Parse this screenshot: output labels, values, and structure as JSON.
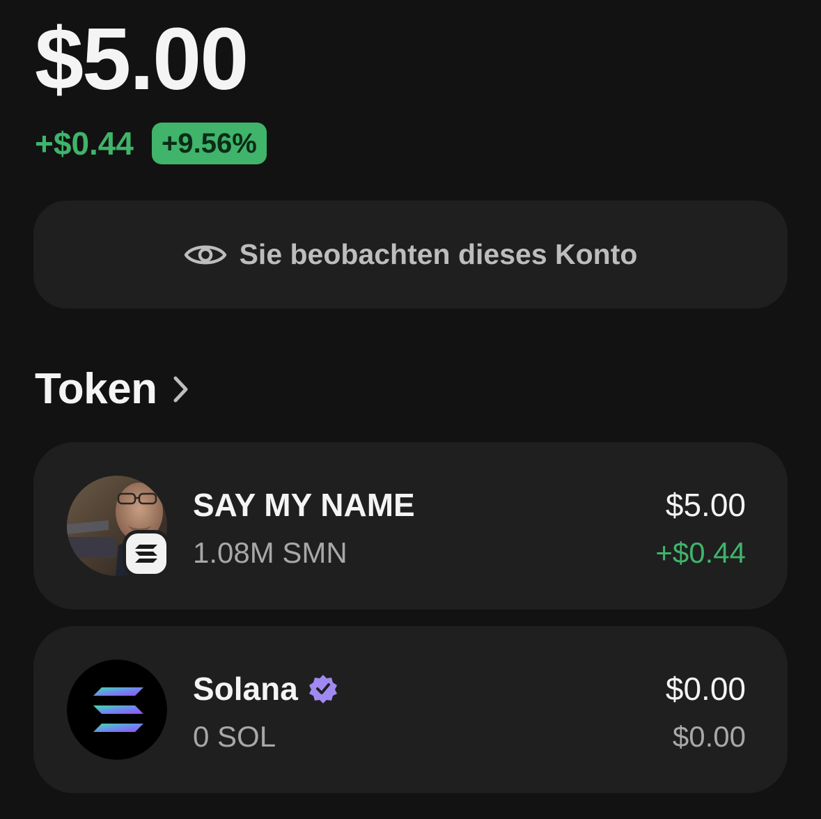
{
  "portfolio": {
    "balance": "$5.00",
    "change_abs": "+$0.44",
    "change_pct": "+9.56%"
  },
  "watch_banner": {
    "text": "Sie beobachten dieses Konto",
    "icon": "eye-icon"
  },
  "tokens_section": {
    "title": "Token",
    "icon": "chevron-right-icon"
  },
  "tokens": [
    {
      "name": "SAY MY NAME",
      "amount": "1.08M SMN",
      "value": "$5.00",
      "change": "+$0.44",
      "change_color": "#3fb46a",
      "icon": "token-avatar-photo",
      "badge_icon": "solana-chain-icon"
    },
    {
      "name": "Solana",
      "amount": "0 SOL",
      "value": "$0.00",
      "change": "$0.00",
      "change_color": "#a8a8a8",
      "icon": "solana-logo-icon",
      "verified": true,
      "verified_icon": "verified-badge-icon",
      "verified_color": "#a08af0"
    }
  ],
  "colors": {
    "background": "#121212",
    "card": "#1f1f1f",
    "positive": "#3fb46a",
    "muted": "#a8a8a8"
  }
}
